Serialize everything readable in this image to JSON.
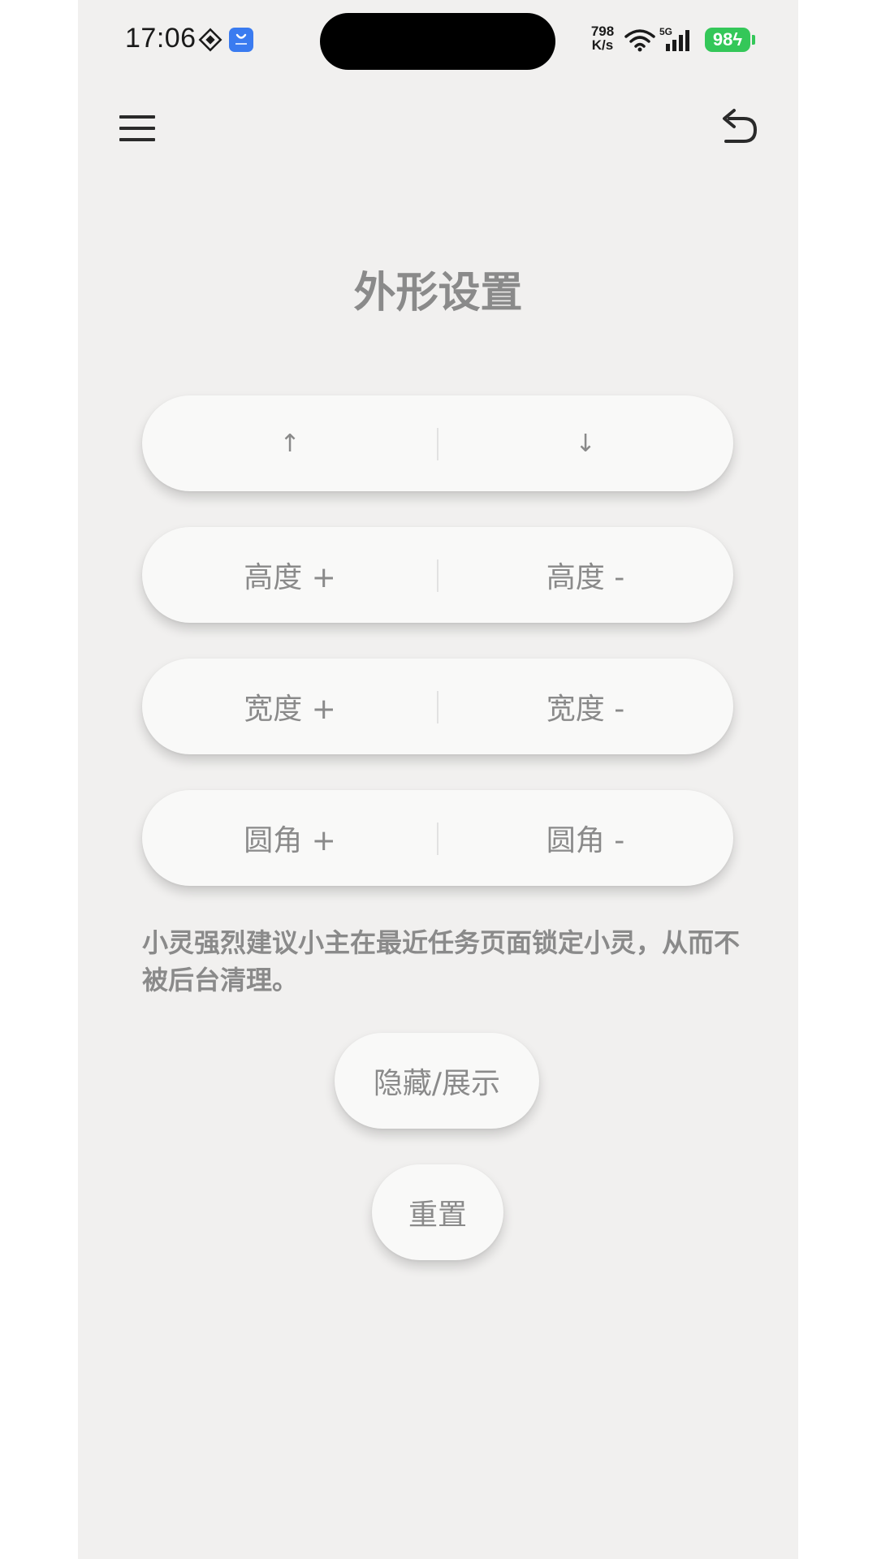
{
  "status_bar": {
    "time": "17:06",
    "net_speed_value": "798",
    "net_speed_unit": "K/s",
    "network_type": "5G",
    "battery": "98"
  },
  "header": {
    "menu_icon": "hamburger-menu-icon",
    "back_icon": "undo-arrow-icon"
  },
  "page": {
    "title": "外形设置"
  },
  "controls": {
    "move_up": "↑",
    "move_down": "↓",
    "height_plus": "高度 +",
    "height_minus": "高度 -",
    "width_plus": "宽度 +",
    "width_minus": "宽度 -",
    "radius_plus": "圆角 +",
    "radius_minus": "圆角 -"
  },
  "tip": "小灵强烈建议小主在最近任务页面锁定小灵，从而不被后台清理。",
  "buttons": {
    "toggle_visibility": "隐藏/展示",
    "reset": "重置"
  },
  "colors": {
    "background": "#f1f0ef",
    "card": "#f9f9f8",
    "text": "#8a8a8a",
    "battery": "#34c759"
  }
}
